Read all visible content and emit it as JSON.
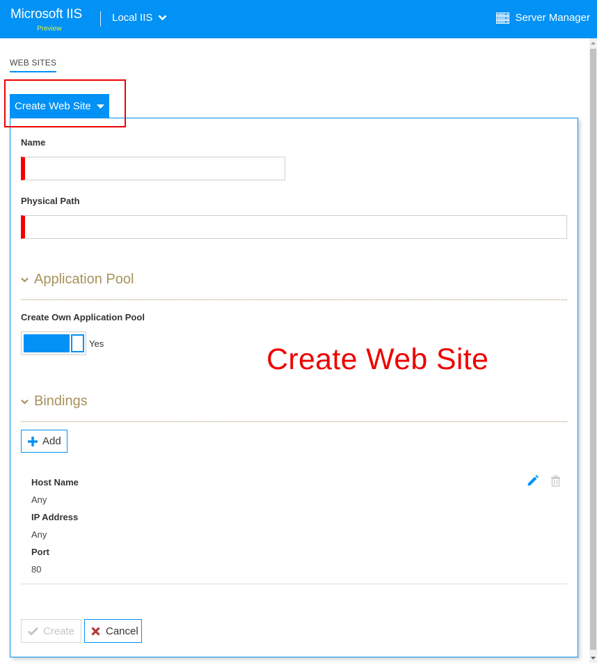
{
  "header": {
    "app_title": "Microsoft IIS",
    "app_subtitle": "Preview",
    "server_select_label": "Local IIS",
    "server_manager_label": "Server Manager",
    "bar_color": "#0291f5"
  },
  "tabs": [
    {
      "label": "WEB SITES",
      "active": true
    }
  ],
  "create_panel": {
    "tab_label": "Create Web Site",
    "name_field": {
      "label": "Name",
      "value": "",
      "required": true
    },
    "physical_path_field": {
      "label": "Physical Path",
      "value": "",
      "required": true
    },
    "application_pool": {
      "title": "Application Pool",
      "expanded": true,
      "create_own_label": "Create Own Application Pool",
      "create_own_value": true,
      "create_own_text": "Yes"
    },
    "bindings": {
      "title": "Bindings",
      "expanded": true,
      "add_label": "Add",
      "items": [
        {
          "host_name_label": "Host Name",
          "host_name": "Any",
          "ip_address_label": "IP Address",
          "ip_address": "Any",
          "port_label": "Port",
          "port": "80"
        }
      ]
    },
    "actions": {
      "create_label": "Create",
      "create_enabled": false,
      "cancel_label": "Cancel"
    }
  },
  "annotation": {
    "caption": "Create Web Site",
    "color": "#ee0000"
  }
}
